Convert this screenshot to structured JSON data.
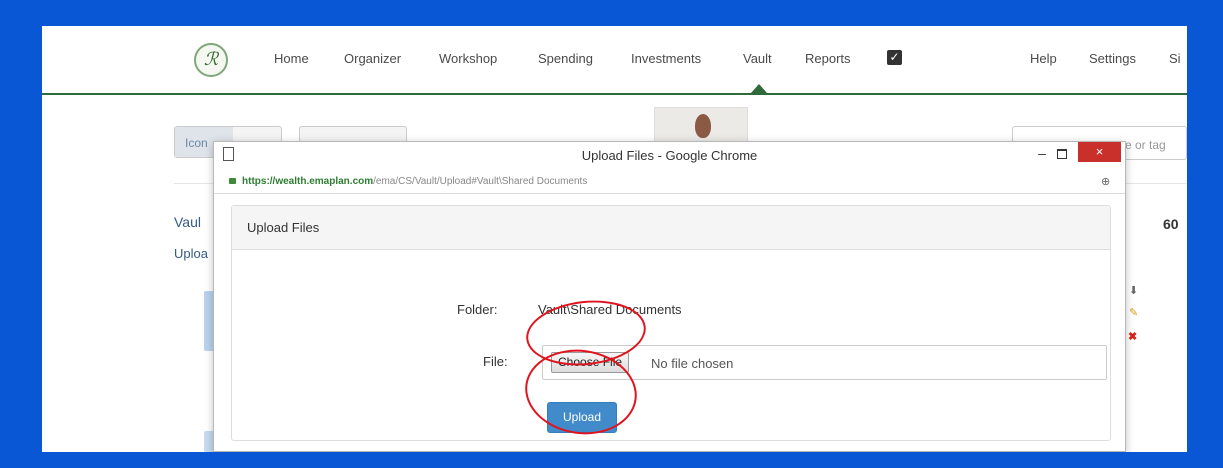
{
  "nav": {
    "items": [
      "Home",
      "Organizer",
      "Workshop",
      "Spending",
      "Investments",
      "Vault",
      "Reports"
    ],
    "right": [
      "Help",
      "Settings",
      "Si"
    ],
    "active": "Vault"
  },
  "background": {
    "view_button": "Icon",
    "search_placeholder": "e or tag",
    "vault_link": "Vaul",
    "upload_link": "Uploa",
    "count": "60"
  },
  "dialog": {
    "title": "Upload Files - Google Chrome",
    "close": "×",
    "url_domain": "https://wealth.emaplan.com",
    "url_path": "/ema/CS/Vault/Upload#Vault\\Shared Documents",
    "panel_title": "Upload Files",
    "folder_label": "Folder:",
    "folder_value": "Vault\\Shared Documents",
    "file_label": "File:",
    "choose_file": "Choose File",
    "no_file": "No file chosen",
    "upload_label": "Upload"
  },
  "colors": {
    "border_blue": "#0a57d6",
    "nav_green": "#2f6b3a",
    "upload_blue": "#428bca",
    "close_red": "#c9302c",
    "annotation_red": "#e0141e"
  }
}
